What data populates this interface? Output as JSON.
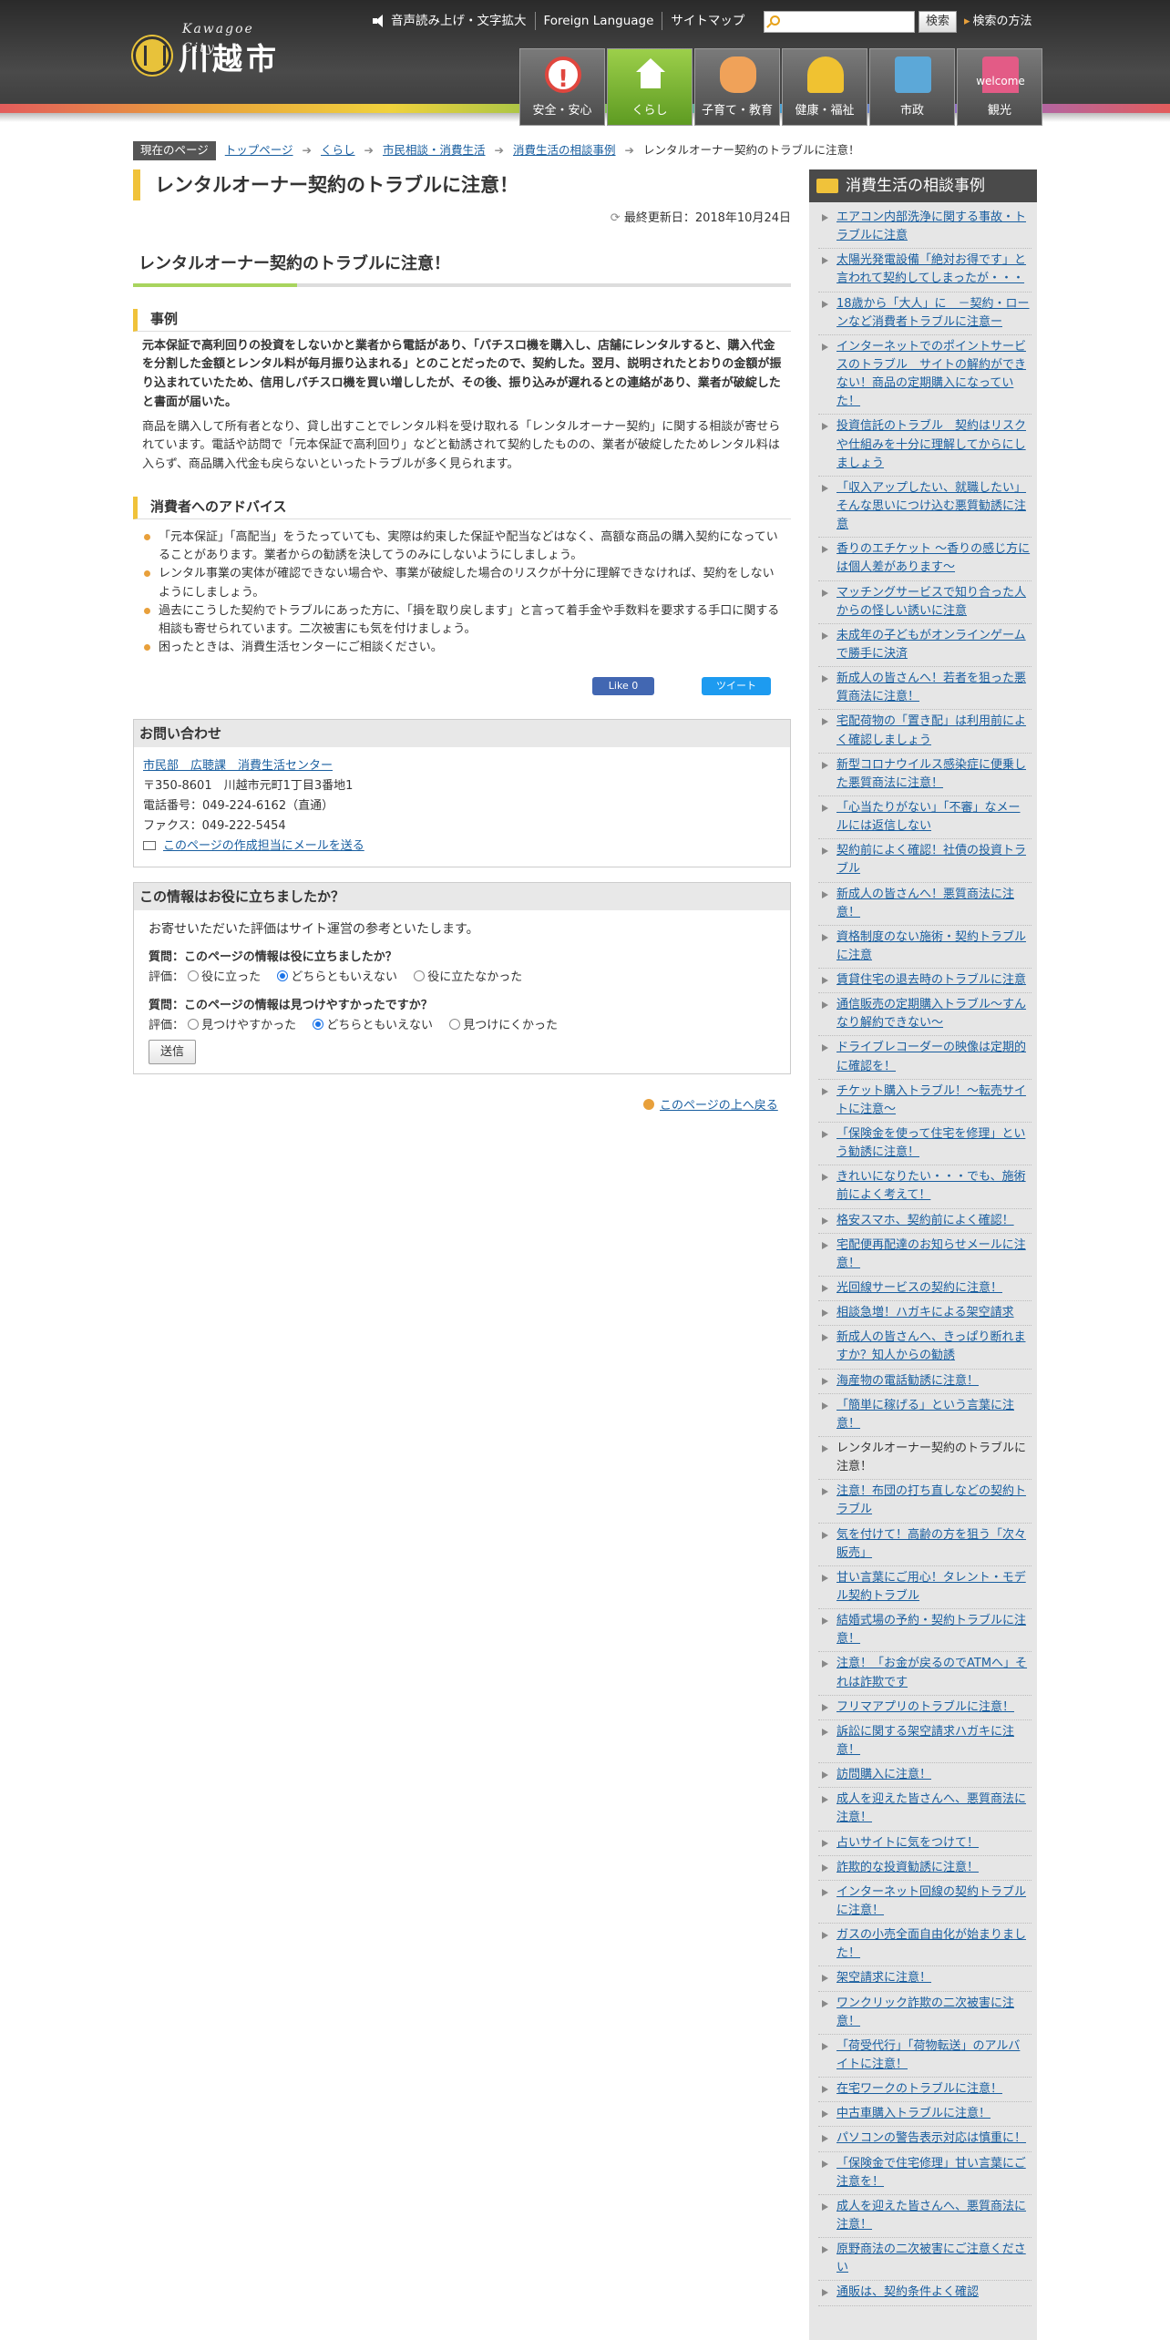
{
  "header": {
    "logo_en": "Kawagoe City",
    "logo_ja": "川越市",
    "util": [
      "音声読み上げ・文字拡大",
      "Foreign Language",
      "サイトマップ"
    ],
    "search_button": "検索",
    "search_help": "検索の方法",
    "nav": [
      "安全・安心",
      "くらし",
      "子育て・教育",
      "健康・福祉",
      "市政",
      "観光"
    ]
  },
  "breadcrumb": {
    "current_label": "現在のページ",
    "items": [
      "トップページ",
      "くらし",
      "市民相談・消費生活",
      "消費生活の相談事例"
    ],
    "current": "レンタルオーナー契約のトラブルに注意！"
  },
  "main": {
    "title": "レンタルオーナー契約のトラブルに注意！",
    "updated": "最終更新日：2018年10月24日",
    "h2": "レンタルオーナー契約のトラブルに注意！",
    "case_heading": "事例",
    "case_bold": "元本保証で高利回りの投資をしないかと業者から電話があり、「パチスロ機を購入し、店舗にレンタルすると、購入代金を分割した金額とレンタル料が毎月振り込まれる」とのことだったので、契約した。翌月、説明されたとおりの金額が振り込まれていたため、信用しパチスロ機を買い増ししたが、その後、振り込みが遅れるとの連絡があり、業者が破綻したと書面が届いた。",
    "case_text": "商品を購入して所有者となり、貸し出すことでレンタル料を受け取れる「レンタルオーナー契約」に関する相談が寄せられています。電話や訪問で「元本保証で高利回り」などと勧誘されて契約したものの、業者が破綻したためレンタル料は入らず、商品購入代金も戻らないといったトラブルが多く見られます。",
    "advice_heading": "消費者へのアドバイス",
    "advice": [
      "「元本保証」「高配当」をうたっていても、実際は約束した保証や配当などはなく、高額な商品の購入契約になっていることがあります。業者からの勧誘を決してうのみにしないようにしましょう。",
      "レンタル事業の実体が確認できない場合や、事業が破綻した場合のリスクが十分に理解できなければ、契約をしないようにしましょう。",
      "過去にこうした契約でトラブルにあった方に、「損を取り戻します」と言って着手金や手数料を要求する手口に関する相談も寄せられています。二次被害にも気を付けましょう。",
      "困ったときは、消費生活センターにご相談ください。"
    ],
    "fb_like": "Like 0",
    "tweet": "ツイート"
  },
  "contact": {
    "heading": "お問い合わせ",
    "dept": "市民部　広聴課　消費生活センター",
    "address": "〒350-8601　川越市元町1丁目3番地1",
    "tel": "電話番号：049-224-6162（直通）",
    "fax": "ファクス：049-222-5454",
    "mail": "このページの作成担当にメールを送る"
  },
  "feedback": {
    "heading": "この情報はお役に立ちましたか？",
    "intro": "お寄せいただいた評価はサイト運営の参考といたします。",
    "q1": "質問：このページの情報は役に立ちましたか？",
    "q1_label": "評価：",
    "q1_opts": [
      "役に立った",
      "どちらともいえない",
      "役に立たなかった"
    ],
    "q2": "質問：このページの情報は見つけやすかったですか？",
    "q2_label": "評価：",
    "q2_opts": [
      "見つけやすかった",
      "どちらともいえない",
      "見つけにくかった"
    ],
    "submit": "送信"
  },
  "to_top": "このページの上へ戻る",
  "sidebar": {
    "heading": "消費生活の相談事例",
    "items": [
      "エアコン内部洗浄に関する事故・トラブルに注意",
      "太陽光発電設備「絶対お得です」と言われて契約してしまったが・・・",
      "18歳から「大人」に　－契約・ローンなど消費者トラブルに注意ー",
      "インターネットでのポイントサービスのトラブル　サイトの解約ができない！商品の定期購入になっていた！",
      "投資信託のトラブル　契約はリスクや仕組みを十分に理解してからにしましょう",
      "「収入アップしたい、就職したい」そんな思いにつけ込む悪質勧誘に注意",
      "香りのエチケット ～香りの感じ方には個人差があります～",
      "マッチングサービスで知り合った人からの怪しい誘いに注意",
      "未成年の子どもがオンラインゲームで勝手に決済",
      "新成人の皆さんへ！若者を狙った悪質商法に注意！",
      "宅配荷物の「置き配」は利用前によく確認しましょう",
      "新型コロナウイルス感染症に便乗した悪質商法に注意！",
      "「心当たりがない」「不審」なメールには返信しない",
      "契約前によく確認！社債の投資トラブル",
      "新成人の皆さんへ！悪質商法に注意！",
      "資格制度のない施術・契約トラブルに注意",
      "賃貸住宅の退去時のトラブルに注意",
      "通信販売の定期購入トラブル～すんなり解約できない～",
      "ドライブレコーダーの映像は定期的に確認を！",
      "チケット購入トラブル！～転売サイトに注意～",
      "「保険金を使って住宅を修理」という勧誘に注意！",
      "きれいになりたい・・・でも、施術前によく考えて！",
      "格安スマホ、契約前によく確認！",
      "宅配便再配達のお知らせメールに注意！",
      "光回線サービスの契約に注意！",
      "相談急増！ハガキによる架空請求",
      "新成人の皆さんへ、きっぱり断れますか？知人からの勧誘",
      "海産物の電話勧誘に注意！",
      "「簡単に稼げる」という言葉に注意！",
      "レンタルオーナー契約のトラブルに注意！",
      "注意！布団の打ち直しなどの契約トラブル",
      "気を付けて！高齢の方を狙う「次々販売」",
      "甘い言葉にご用心！タレント・モデル契約トラブル",
      "結婚式場の予約・契約トラブルに注意！",
      "注意！「お金が戻るのでATMへ」それは詐欺です",
      "フリマアプリのトラブルに注意！",
      "訴訟に関する架空請求ハガキに注意！",
      "訪問購入に注意！",
      "成人を迎えた皆さんへ、悪質商法に注意！",
      "占いサイトに気をつけて！",
      "詐欺的な投資勧誘に注意！",
      "インターネット回線の契約トラブルに注意！",
      "ガスの小売全面自由化が始まりました！",
      "架空請求に注意！",
      "ワンクリック詐欺の二次被害に注意！",
      "「荷受代行」「荷物転送」のアルバイトに注意！",
      "在宅ワークのトラブルに注意！",
      "中古車購入トラブルに注意！",
      "パソコンの警告表示対応は慎重に！",
      "「保険金で住宅修理」甘い言葉にご注意を！",
      "成人を迎えた皆さんへ、悪質商法に注意！",
      "原野商法の二次被害にご注意ください",
      "通販は、契約条件よく確認"
    ],
    "current_index": 29
  }
}
